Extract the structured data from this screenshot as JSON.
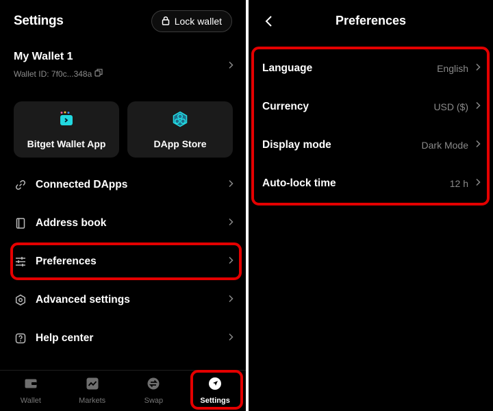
{
  "settings": {
    "title": "Settings",
    "lock_label": "Lock wallet",
    "wallet": {
      "name": "My Wallet 1",
      "id": "Wallet ID: 7f0c...348a"
    },
    "cards": [
      {
        "label": "Bitget Wallet App",
        "icon": "app-icon"
      },
      {
        "label": "DApp Store",
        "icon": "dapp-store-icon"
      }
    ],
    "menu": [
      {
        "label": "Connected DApps",
        "icon": "link-icon"
      },
      {
        "label": "Address book",
        "icon": "book-icon"
      },
      {
        "label": "Preferences",
        "icon": "sliders-icon"
      },
      {
        "label": "Advanced settings",
        "icon": "hexagon-icon"
      },
      {
        "label": "Help center",
        "icon": "help-icon"
      }
    ],
    "tabs": [
      {
        "label": "Wallet",
        "icon": "wallet-icon",
        "active": false
      },
      {
        "label": "Markets",
        "icon": "chart-icon",
        "active": false
      },
      {
        "label": "Swap",
        "icon": "swap-icon",
        "active": false
      },
      {
        "label": "Settings",
        "icon": "compass-icon",
        "active": true
      }
    ]
  },
  "preferences": {
    "title": "Preferences",
    "items": [
      {
        "label": "Language",
        "value": "English"
      },
      {
        "label": "Currency",
        "value": "USD ($)"
      },
      {
        "label": "Display mode",
        "value": "Dark Mode"
      },
      {
        "label": "Auto-lock time",
        "value": "12 h"
      }
    ]
  },
  "colors": {
    "background": "#000000",
    "card": "#1b1b1b",
    "accent": "#22d8e0",
    "highlight": "#e40000",
    "muted": "#8a8a8a"
  }
}
